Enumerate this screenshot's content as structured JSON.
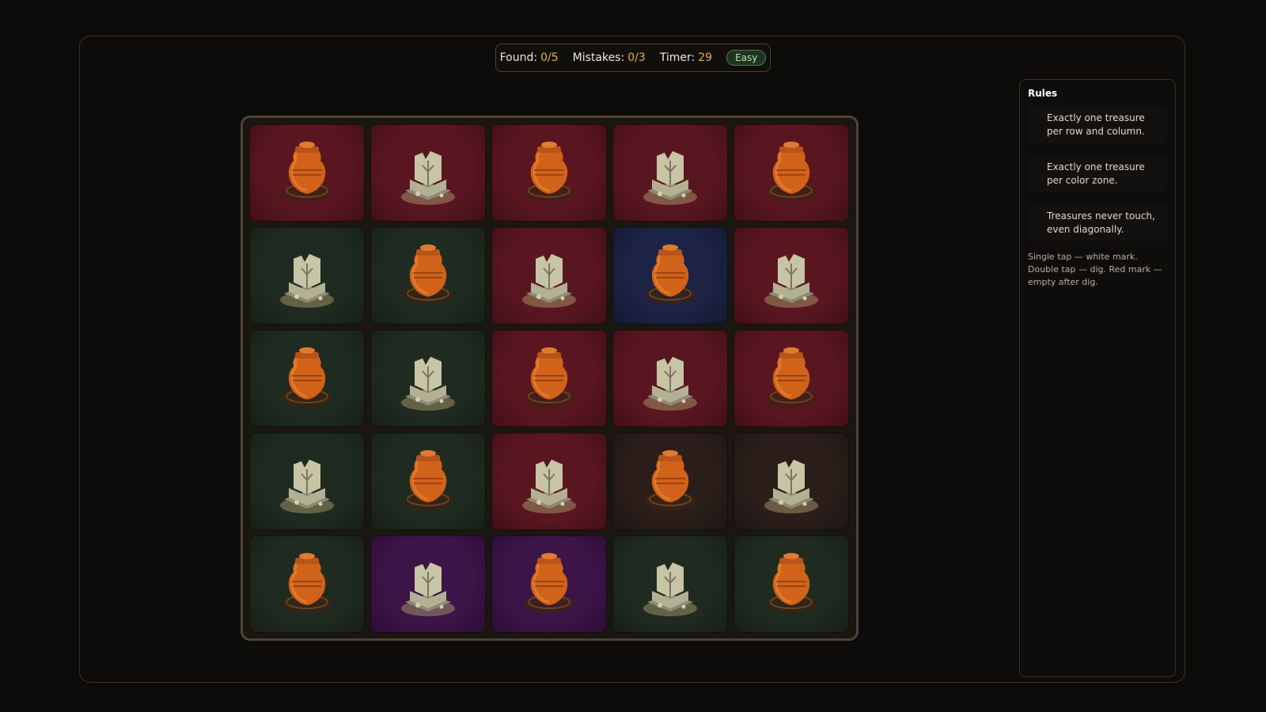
{
  "status": {
    "found_label": "Found:",
    "found_value": "0/5",
    "mistakes_label": "Mistakes:",
    "mistakes_value": "0/3",
    "timer_label": "Timer:",
    "timer_value": "29",
    "difficulty": "Easy"
  },
  "rules": {
    "title": "Rules",
    "items": [
      "Exactly one treasure per row and column.",
      "Exactly one treasure per color zone.",
      "Treasures never touch, even diagonally."
    ],
    "hint": "Single tap — white mark. Double tap — dig. Red mark — empty after dig."
  },
  "zone_colors": {
    "red": "#5a1620",
    "green": "#1f2b20",
    "blue": "#1c2344",
    "brown": "#2b1e1a",
    "purple": "#3d1448"
  },
  "grid": {
    "rows": 5,
    "cols": 5,
    "zones": [
      [
        "red",
        "red",
        "red",
        "red",
        "red"
      ],
      [
        "green",
        "green",
        "red",
        "blue",
        "red"
      ],
      [
        "green",
        "green",
        "red",
        "red",
        "red"
      ],
      [
        "green",
        "green",
        "red",
        "brown",
        "brown"
      ],
      [
        "green",
        "purple",
        "purple",
        "green",
        "green"
      ]
    ],
    "icons": [
      [
        "vase-icon",
        "pillar-icon",
        "vase-icon",
        "pillar-icon",
        "vase-icon"
      ],
      [
        "pillar-icon",
        "vase-icon",
        "pillar-icon",
        "vase-icon",
        "pillar-icon"
      ],
      [
        "vase-icon",
        "pillar-icon",
        "vase-icon",
        "pillar-icon",
        "vase-icon"
      ],
      [
        "pillar-icon",
        "vase-icon",
        "pillar-icon",
        "vase-icon",
        "pillar-icon"
      ],
      [
        "vase-icon",
        "pillar-icon",
        "vase-icon",
        "pillar-icon",
        "vase-icon"
      ]
    ]
  }
}
